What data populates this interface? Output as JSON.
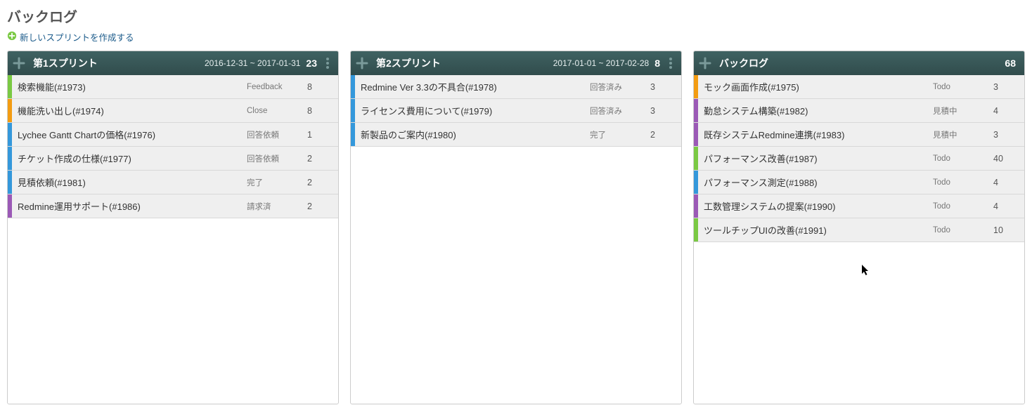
{
  "page_title": "バックログ",
  "new_sprint_label": "新しいスプリントを作成する",
  "tracker_colors": {
    "green": "#7ac943",
    "orange": "#f39c12",
    "blue": "#3498db",
    "purple": "#9b59b6"
  },
  "columns": [
    {
      "title": "第1スプリント",
      "date_range": "2016-12-31 ~ 2017-01-31",
      "total": "23",
      "show_menu": true,
      "items": [
        {
          "title": "検索機能(#1973)",
          "status": "Feedback",
          "points": "8",
          "color": "green"
        },
        {
          "title": "機能洗い出し(#1974)",
          "status": "Close",
          "points": "8",
          "color": "orange"
        },
        {
          "title": "Lychee Gantt Chartの価格(#1976)",
          "status": "回答依頼",
          "points": "1",
          "color": "blue"
        },
        {
          "title": "チケット作成の仕様(#1977)",
          "status": "回答依頼",
          "points": "2",
          "color": "blue"
        },
        {
          "title": "見積依頼(#1981)",
          "status": "完了",
          "points": "2",
          "color": "blue"
        },
        {
          "title": "Redmine運用サポート(#1986)",
          "status": "請求済",
          "points": "2",
          "color": "purple"
        }
      ]
    },
    {
      "title": "第2スプリント",
      "date_range": "2017-01-01 ~ 2017-02-28",
      "total": "8",
      "show_menu": true,
      "items": [
        {
          "title": "Redmine Ver 3.3の不具合(#1978)",
          "status": "回答済み",
          "points": "3",
          "color": "blue"
        },
        {
          "title": "ライセンス費用について(#1979)",
          "status": "回答済み",
          "points": "3",
          "color": "blue"
        },
        {
          "title": "新製品のご案内(#1980)",
          "status": "完了",
          "points": "2",
          "color": "blue"
        }
      ]
    },
    {
      "title": "バックログ",
      "date_range": "",
      "total": "68",
      "show_menu": false,
      "items": [
        {
          "title": "モック画面作成(#1975)",
          "status": "Todo",
          "points": "3",
          "color": "orange"
        },
        {
          "title": "勤怠システム構築(#1982)",
          "status": "見積中",
          "points": "4",
          "color": "purple"
        },
        {
          "title": "既存システムRedmine連携(#1983)",
          "status": "見積中",
          "points": "3",
          "color": "purple"
        },
        {
          "title": "パフォーマンス改善(#1987)",
          "status": "Todo",
          "points": "40",
          "color": "green"
        },
        {
          "title": "パフォーマンス測定(#1988)",
          "status": "Todo",
          "points": "4",
          "color": "blue"
        },
        {
          "title": "工数管理システムの提案(#1990)",
          "status": "Todo",
          "points": "4",
          "color": "purple"
        },
        {
          "title": "ツールチップUIの改善(#1991)",
          "status": "Todo",
          "points": "10",
          "color": "green"
        }
      ]
    }
  ]
}
